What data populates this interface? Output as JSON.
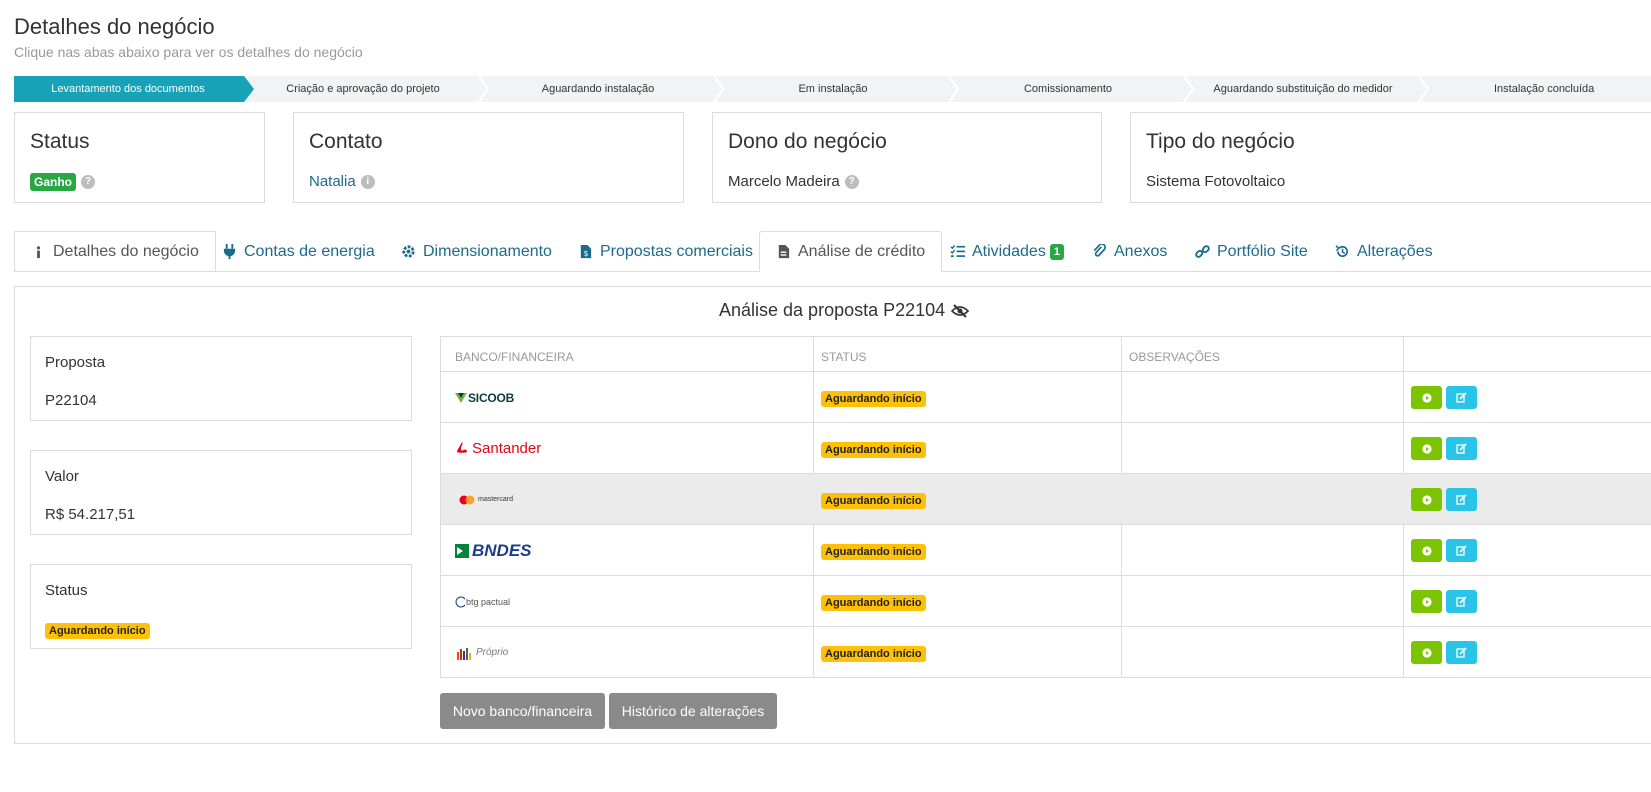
{
  "page": {
    "title": "Detalhes do negócio",
    "subtitle": "Clique nas abas abaixo para ver os detalhes do negócio"
  },
  "pipeline": {
    "stages": [
      "Levantamento dos documentos",
      "Criação e aprovação do projeto",
      "Aguardando instalação",
      "Em instalação",
      "Comissionamento",
      "Aguardando substituição do medidor",
      "Instalação concluída"
    ],
    "active_index": 0
  },
  "info": {
    "status": {
      "label": "Status",
      "value": "Ganho"
    },
    "contato": {
      "label": "Contato",
      "value": "Natalia"
    },
    "dono": {
      "label": "Dono do negócio",
      "value": "Marcelo Madeira"
    },
    "tipo": {
      "label": "Tipo do negócio",
      "value": "Sistema Fotovoltaico"
    }
  },
  "tabs": [
    {
      "label": "Detalhes do negócio",
      "icon": "info-icon"
    },
    {
      "label": "Contas de energia",
      "icon": "plug-icon"
    },
    {
      "label": "Dimensionamento",
      "icon": "gear-icon"
    },
    {
      "label": "Propostas comerciais",
      "icon": "file-dollar-icon"
    },
    {
      "label": "Análise de crédito",
      "icon": "file-icon",
      "active": true
    },
    {
      "label": "Atividades",
      "icon": "tasks-icon",
      "count": "1"
    },
    {
      "label": "Anexos",
      "icon": "paperclip-icon"
    },
    {
      "label": "Portfólio Site",
      "icon": "link-icon"
    },
    {
      "label": "Alterações",
      "icon": "history-icon"
    }
  ],
  "analysis": {
    "title": "Análise da proposta P22104",
    "proposta": {
      "label": "Proposta",
      "value": "P22104"
    },
    "valor": {
      "label": "Valor",
      "value": "R$ 54.217,51"
    },
    "status": {
      "label": "Status",
      "value": "Aguardando início"
    },
    "table": {
      "columns": [
        "BANCO/FINANCEIRA",
        "STATUS",
        "OBSERVAÇÕES",
        ""
      ],
      "rows": [
        {
          "bank": "SICOOB",
          "status": "Aguardando início",
          "obs": ""
        },
        {
          "bank": "Santander",
          "status": "Aguardando início",
          "obs": ""
        },
        {
          "bank": "mastercard",
          "status": "Aguardando início",
          "obs": ""
        },
        {
          "bank": "BNDES",
          "status": "Aguardando início",
          "obs": ""
        },
        {
          "bank": "btg pactual",
          "status": "Aguardando início",
          "obs": ""
        },
        {
          "bank": "Próprio",
          "status": "Aguardando início",
          "obs": ""
        }
      ]
    },
    "buttons": {
      "new_bank": "Novo banco/financeira",
      "history": "Histórico de alterações"
    }
  },
  "colors": {
    "accent": "#17a2b8",
    "link": "#1b6b8d",
    "success": "#28a745",
    "warning": "#ffc107",
    "go_button": "#7cc300",
    "edit_button": "#2bc4e9"
  }
}
